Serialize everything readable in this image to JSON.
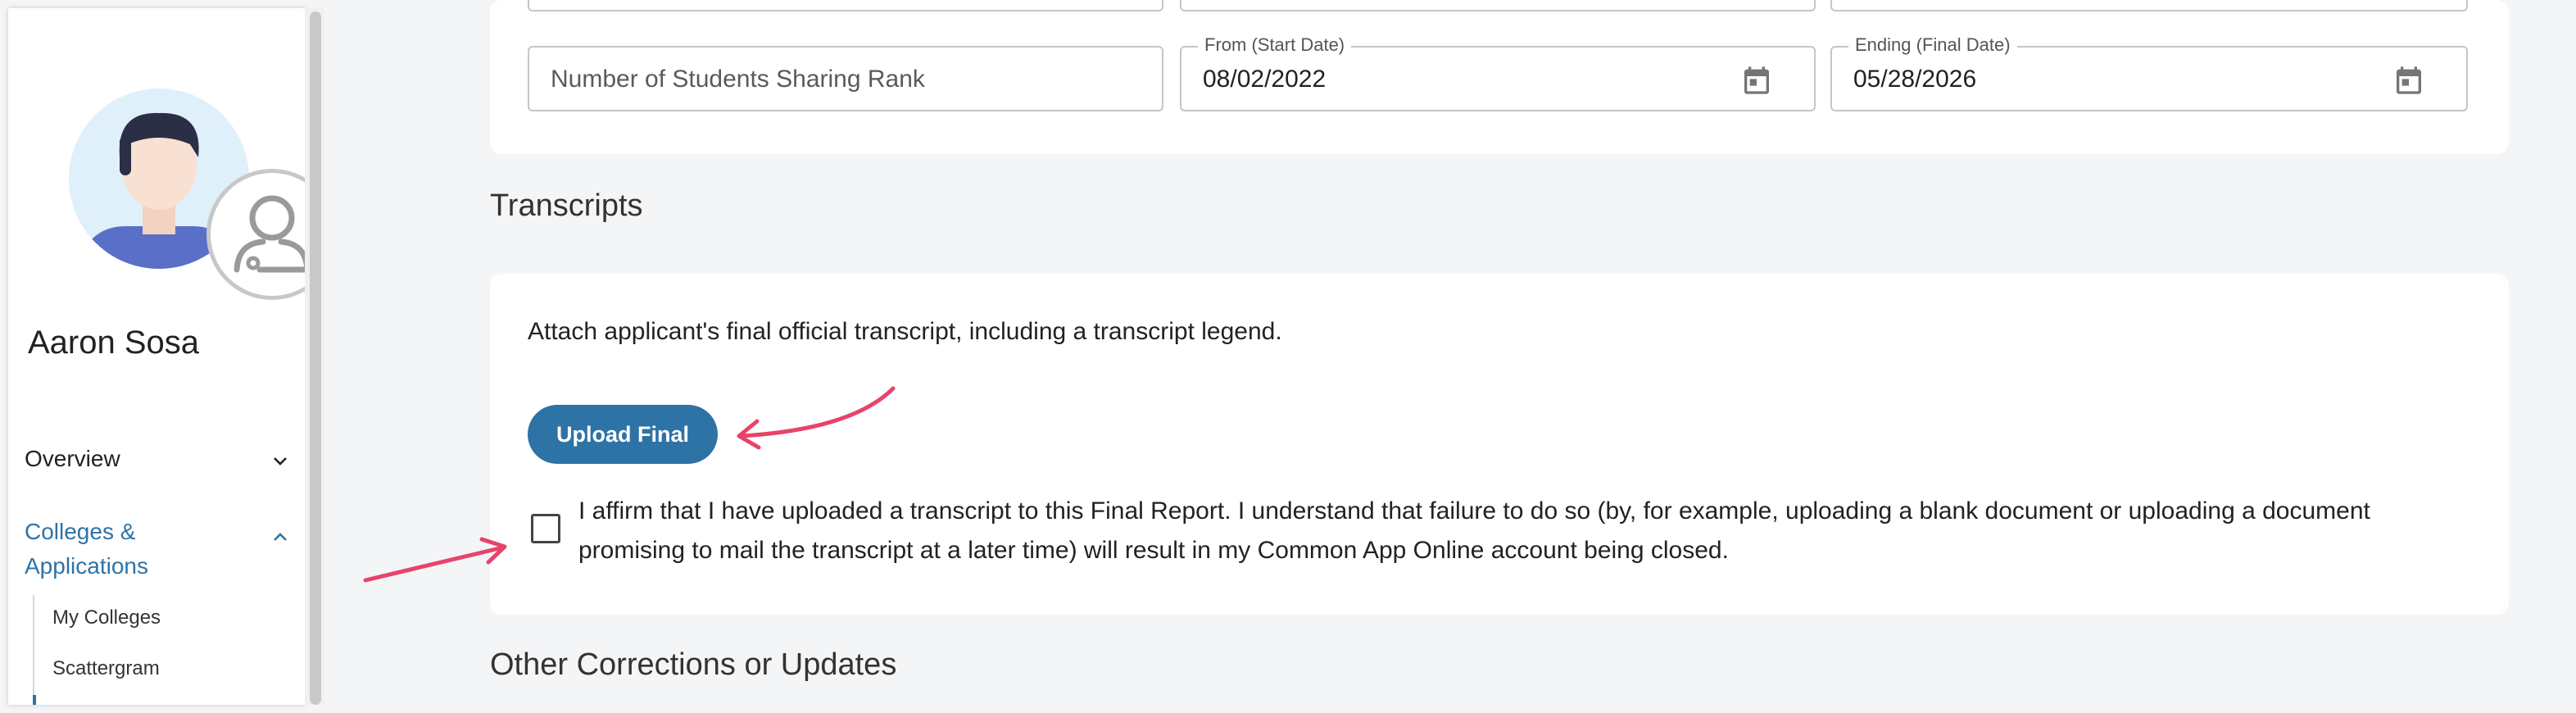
{
  "sidebar": {
    "user_name": "Aaron Sosa",
    "nav": {
      "overview": "Overview",
      "colleges": "Colleges & Applications",
      "sub_items": [
        "My Colleges",
        "Scattergram"
      ]
    }
  },
  "dates": {
    "rank_placeholder": "Number of Students Sharing Rank",
    "start_label": "From (Start Date)",
    "start_value": "08/02/2022",
    "end_label": "Ending (Final Date)",
    "end_value": "05/28/2026"
  },
  "transcripts": {
    "title": "Transcripts",
    "instructions": "Attach applicant's final official transcript, including a transcript legend.",
    "upload_label": "Upload Final",
    "affirm_text": "I affirm that I have uploaded a transcript to this Final Report. I understand that failure to do so (by, for example, uploading a blank document or uploading a document promising to mail the transcript at a later time) will result in my Common App Online account being closed.",
    "affirm_checked": false
  },
  "other": {
    "title": "Other Corrections or Updates"
  },
  "icons": {
    "calendar": "calendar-icon",
    "chevron_down": "chevron-down-icon",
    "chevron_up": "chevron-up-icon",
    "user_outline": "user-outline-icon"
  },
  "colors": {
    "accent": "#2e73a6",
    "annotation_arrow": "#e8436b",
    "background": "#f4f5f7"
  }
}
